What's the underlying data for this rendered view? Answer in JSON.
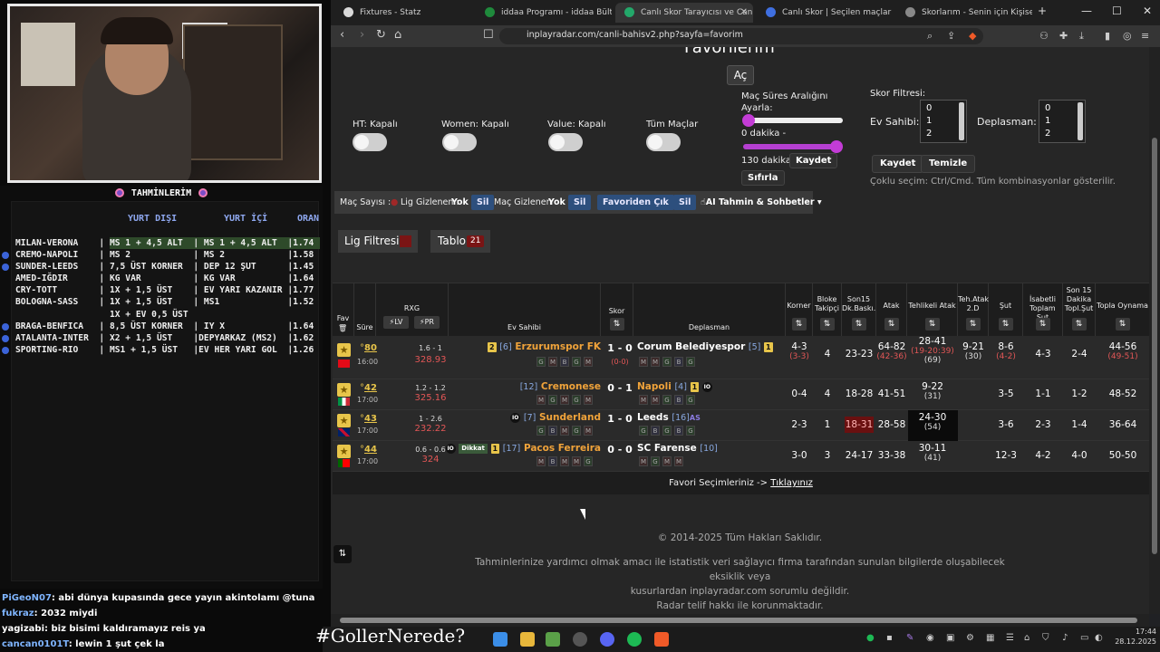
{
  "stream": {
    "pred_title": "TAHMİNLERİM",
    "columns": {
      "away": "YURT DIŞI",
      "home": "YURT İÇİ",
      "rate": "ORAN"
    },
    "rows": [
      "MILAN-VERONA    | MS 1 + 4,5 ALT  | MS 1 + 4,5 ALT  |1.74",
      "CREMO-NAPOLI    | MS 2            | MS 2            |1.58",
      "SUNDER-LEEDS    | 7,5 ÜST KORNER  | DEP 12 ŞUT      |1.45",
      "AMED-IĞDIR      | KG VAR          | KG VAR          |1.64",
      "CRY-TOTT        | 1X + 1,5 ÜST    | EV YARI KAZANIR |1.77",
      "BOLOGNA-SASS    | 1X + 1,5 ÜST    | MS1             |1.52",
      "                  1X + EV 0,5 ÜST",
      "BRAGA-BENFICA   | 8,5 ÜST KORNER  | IY X            |1.64",
      "ATALANTA-INTER  | X2 + 1,5 ÜST    |DEPYARKAZ (MS2)  |1.62",
      "SPORTING-RIO    | MS1 + 1,5 ÜST   |EV HER YARI GOL  |1.26"
    ],
    "chat": [
      {
        "user": "PiGeoN07",
        "msg": ": abi dünya kupasında gece yayın akintolamı @tuna"
      },
      {
        "user": "fukraz",
        "msg": ": 2032 miydi"
      },
      {
        "user": "yagizabi",
        "msg": ": biz bisimi kaldıramayız reis ya"
      },
      {
        "user": "cancan0101T",
        "msg": ": lewin 1 şut çek la"
      }
    ],
    "hashtag": "#GollerNerede?"
  },
  "browser": {
    "tabs": [
      {
        "title": "Fixtures - Statz",
        "color": "#d9d9d9"
      },
      {
        "title": "iddaa Programı - iddaa Bülteni | id",
        "color": "#1f8a3c"
      },
      {
        "title": "Canlı Skor Tarayıcısı ve Canlı S",
        "color": "#23a86a"
      },
      {
        "title": "Canlı Skor | Seçilen maçlar için ca",
        "color": "#3f6fe0"
      },
      {
        "title": "Skorlarım - Senin için Kişiselleştiril",
        "color": "#888888"
      }
    ],
    "url": "inplayradar.com/canli-bahisv2.php?sayfa=favorim"
  },
  "page": {
    "title": "Favorilerim",
    "open_button": "Aç",
    "toggles": [
      "HT: Kapalı",
      "Women: Kapalı",
      "Value: Kapalı",
      "Tüm Maçlar"
    ],
    "duration": {
      "label": "Maç Süres Aralığını Ayarla:",
      "min": "0 dakika -",
      "max": "130 dakika",
      "save": "Kaydet",
      "reset": "Sıfırla"
    },
    "score_filter": {
      "label": "Skor Filtresi:",
      "home_label": "Ev Sahibi:",
      "away_label": "Deplasman:",
      "options": [
        "0",
        "1",
        "2"
      ],
      "save": "Kaydet",
      "clear": "Temizle",
      "note": "Çoklu seçim: Ctrl/Cmd. Tüm kombinasyonlar gösterilir."
    },
    "filterbar": {
      "match_count": "Maç Sayısı :",
      "hidden_leagues": "Lig Gizlenen :",
      "none1": "Yok",
      "del1": "Sil",
      "hidden_matches": "Maç Gizlenen :",
      "none2": "Yok",
      "del2": "Sil",
      "remove_fav": "Favoriden Çık",
      "dot": ".",
      "del3": "Sil",
      "ai": "AI Tahmin & Sohbetler"
    },
    "league_filter": "Lig Filtresi",
    "table_btn": "Tablo",
    "table_count": "21",
    "headers": {
      "fav": "Fav",
      "sure": "Süre",
      "rxg": "RXG",
      "lv": "LV",
      "pr": "PR",
      "home": "Ev Sahibi",
      "score": "Skor",
      "away": "Deplasman",
      "korner": "Korner",
      "bloke": "Bloke Takipçi",
      "son15": "Son15 Dk.Baskı.",
      "atak": "Atak",
      "tatak": "Tehlikeli Atak",
      "tatak2": "Teh.Atak 2.D",
      "sut": "Şut",
      "isabet": "İsabetli Toplam Şut",
      "son15sut": "Son 15 Dakika Topl.Şut",
      "topla": "Topla Oynama"
    },
    "matches": [
      {
        "minute": "80",
        "time": "16:00",
        "rxg": "1.6 - 1",
        "rxg_total": "328.93",
        "home": "Erzurumspor FK",
        "home_rank": "[6]",
        "home_card": "2",
        "home_form": [
          "G",
          "M",
          "B",
          "G",
          "M"
        ],
        "score": "1 - 0",
        "ht": "(0-0)",
        "away": "Corum Belediyespor",
        "away_rank": "[5]",
        "away_card": "1",
        "away_form": [
          "M",
          "M",
          "G",
          "B",
          "G"
        ],
        "korner": "4-3",
        "korner_sub": "(3-3)",
        "bloke": "4",
        "son15": "23-23",
        "atak": "64-82",
        "atak_sub": "(42-36)",
        "tatak": "28-41",
        "tatak_sub": "(19-20:39)",
        "tatak_sub2": "(69)",
        "tatak2": "9-21",
        "tatak2_sub": "(30)",
        "sut": "8-6",
        "sut_sub": "(4-2)",
        "isabet": "4-3",
        "son15sut": "2-4",
        "topla": "44-56",
        "topla_sub": "(49-51)"
      },
      {
        "minute": "42",
        "time": "17:00",
        "rxg": "1.2 - 1.2",
        "rxg_total": "325.16",
        "home": "Cremonese",
        "home_rank": "[12]",
        "home_card": "",
        "home_form": [
          "M",
          "G",
          "M",
          "G",
          "M"
        ],
        "score": "0 - 1",
        "ht": "",
        "away": "Napoli",
        "away_rank": "[4]",
        "away_card": "1",
        "away_form": [
          "M",
          "M",
          "G",
          "B",
          "G"
        ],
        "korner": "0-4",
        "korner_sub": "",
        "bloke": "4",
        "son15": "18-28",
        "atak": "41-51",
        "atak_sub": "",
        "tatak": "9-22",
        "tatak_sub": "(31)",
        "tatak_sub2": "",
        "tatak2": "",
        "tatak2_sub": "",
        "sut": "3-5",
        "sut_sub": "",
        "isabet": "1-1",
        "son15sut": "1-2",
        "topla": "48-52",
        "topla_sub": ""
      },
      {
        "minute": "43",
        "time": "17:00",
        "rxg": "1 - 2.6",
        "rxg_total": "232.22",
        "home": "Sunderland",
        "home_rank": "[7]",
        "home_card": "",
        "home_form": [
          "G",
          "B",
          "M",
          "G",
          "M"
        ],
        "score": "1 - 0",
        "ht": "",
        "away": "Leeds",
        "away_rank": "[16]",
        "away_card": "",
        "away_form": [
          "G",
          "B",
          "G",
          "B",
          "G"
        ],
        "korner": "2-3",
        "korner_sub": "",
        "bloke": "1",
        "son15": "18-31",
        "atak": "28-58",
        "atak_sub": "",
        "tatak": "24-30",
        "tatak_sub": "(54)",
        "tatak_sub2": "",
        "tatak2": "",
        "tatak2_sub": "",
        "sut": "3-6",
        "sut_sub": "",
        "isabet": "2-3",
        "son15sut": "1-4",
        "topla": "36-64",
        "topla_sub": ""
      },
      {
        "minute": "44",
        "time": "17:00",
        "rxg": "0.6 - 0.6",
        "rxg_total": "324",
        "home": "Pacos Ferreira",
        "home_rank": "[17]",
        "home_card": "1",
        "home_form": [
          "M",
          "B",
          "M",
          "M",
          "G"
        ],
        "score": "0 - 0",
        "ht": "",
        "away": "SC Farense",
        "away_rank": "[10]",
        "away_card": "",
        "away_form": [
          "M",
          "G",
          "M",
          "M"
        ],
        "korner": "3-0",
        "korner_sub": "",
        "bloke": "3",
        "son15": "24-17",
        "atak": "33-38",
        "atak_sub": "",
        "tatak": "30-11",
        "tatak_sub": "(41)",
        "tatak_sub2": "",
        "tatak2": "",
        "tatak2_sub": "",
        "sut": "12-3",
        "sut_sub": "",
        "isabet": "4-2",
        "son15sut": "4-0",
        "topla": "50-50",
        "topla_sub": ""
      }
    ],
    "dikkat": "Dikkat",
    "fav_footer": "Favori Seçimleriniz ->",
    "fav_link": "Tıklayınız",
    "copyright": "© 2014-2025 Tüm Hakları Saklıdır.",
    "disclaimer1": "Tahminlerinize yardımcı olmak amacı ile istatistik veri sağlayıcı firma tarafından sunulan bilgilerde oluşabilecek eksiklik veya",
    "disclaimer2": "kusurlardan inplayradar.com sorumlu değildir.",
    "disclaimer3": "Radar telif hakkı ile korunmaktadır."
  },
  "taskbar": {
    "time": "17:44",
    "date": "28.12.2025"
  }
}
